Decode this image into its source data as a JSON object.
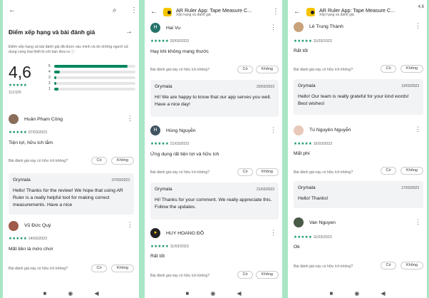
{
  "p1": {
    "section_title": "Điểm xếp hạng và bài đánh giá",
    "section_desc": "Điểm xếp hạng và bài đánh giá đã được xác minh và do những người sử dụng cùng loại thiết bị với bạn đưa ra ⓘ",
    "rating": "4,6",
    "rating_count": "113.525",
    "bars": [
      {
        "label": "5",
        "fill": 0.9
      },
      {
        "label": "4",
        "fill": 0.07
      },
      {
        "label": "3",
        "fill": 0.03
      },
      {
        "label": "2",
        "fill": 0.03
      },
      {
        "label": "1",
        "fill": 0.05
      }
    ],
    "r1": {
      "name": "Huân Phạm Công",
      "date": "07/03/2023",
      "text": "Tiện lợi, hữu ích lắm",
      "q": "Bài đánh giá này có hữu ích không?",
      "yes": "Có",
      "no": "Không",
      "dev": "Grymala",
      "ddate": "07/03/2023",
      "dtext": "Hello! Thanks for the review! We hope that using AR Ruler is a really helpful tool for making correct measurements. Have a nice"
    },
    "r2": {
      "name": "Vũ Đức Quý",
      "date": "14/03/2023",
      "text": "Mất tiền là mớo chơi",
      "q": "Bài đánh giá này có hữu ích không?",
      "yes": "Có",
      "no": "Không"
    }
  },
  "app": {
    "title": "AR Ruler App: Tape Measure C...",
    "sub": "Xếp hạng và đánh giá",
    "time": "4,6"
  },
  "p2": {
    "r1": {
      "avatar": "H",
      "name": "Hai Vu",
      "date": "20/03/2023",
      "text": "Hay khi không mang thước",
      "q": "Bài đánh giá này có hữu ích không?",
      "yes": "Có",
      "no": "Không",
      "dev": "Grymala",
      "ddate": "20/03/2023",
      "dtext": "Hi! We are happy to know that our app serves you well. Have a nice day!"
    },
    "r2": {
      "avatar": "H",
      "name": "Hùng Nguyễn",
      "date": "21/03/2023",
      "text": "Ứng dụng rất tiện lợi và hữu ích",
      "q": "Bài đánh giá này có hữu ích không?",
      "yes": "Có",
      "no": "Không",
      "dev": "Grymala",
      "ddate": "21/03/2023",
      "dtext": "Hi! Thanks for your comment. We really appreciate this. Follow the updates."
    },
    "r3": {
      "name": "HUY HOANG ĐỖ",
      "date": "11/03/2023",
      "text": "Rất tốt",
      "q": "Bài đánh giá này có hữu ích không?",
      "yes": "Có",
      "no": "Không"
    }
  },
  "p3": {
    "r1": {
      "name": "Lê Trung Thành",
      "date": "11/03/2023",
      "text": "Rất tốt",
      "q": "Bài đánh giá này có hữu ích không?",
      "yes": "Có",
      "no": "Không",
      "dev": "Grymala",
      "ddate": "13/03/2023",
      "dtext": "Hello! Our team is really grateful for your kind words! Best wishes!"
    },
    "r2": {
      "name": "Tú Nguyên Nguyễn",
      "date": "16/03/2023",
      "text": "Mất phí",
      "q": "Bài đánh giá này có hữu ích không?",
      "yes": "Có",
      "no": "Không",
      "dev": "Grymala",
      "ddate": "17/03/2023",
      "dtext": "Hello! Thanks!"
    },
    "r3": {
      "name": "Van Nguyen",
      "date": "11/03/2023",
      "text": "Ok",
      "q": "Bài đánh giá này có hữu ích không?",
      "yes": "Có",
      "no": "Không"
    }
  },
  "stars": "★★★★★",
  "nav": {
    "back": "◀",
    "home": "◉",
    "recent": "■"
  }
}
